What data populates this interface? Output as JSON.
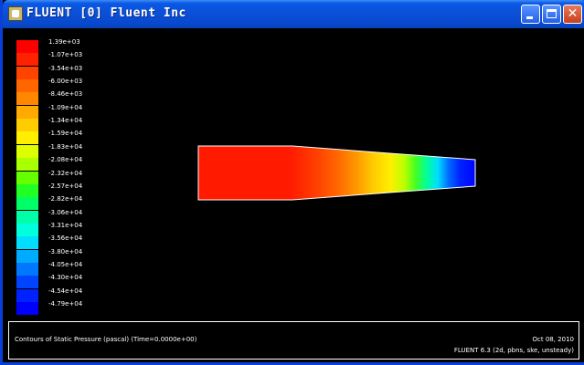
{
  "window": {
    "title": "FLUENT  [0] Fluent Inc",
    "buttons": {
      "minimize": "minimize-icon",
      "maximize": "maximize-icon",
      "close": "close-icon"
    }
  },
  "colormap": {
    "labels": [
      "1.39e+03",
      "-1.07e+03",
      "-3.54e+03",
      "-6.00e+03",
      "-8.46e+03",
      "-1.09e+04",
      "-1.34e+04",
      "-1.59e+04",
      "-1.83e+04",
      "-2.08e+04",
      "-2.32e+04",
      "-2.57e+04",
      "-2.82e+04",
      "-3.06e+04",
      "-3.31e+04",
      "-3.56e+04",
      "-3.80e+04",
      "-4.05e+04",
      "-4.30e+04",
      "-4.54e+04",
      "-4.79e+04"
    ],
    "colors": [
      "#ff0000",
      "#ff2200",
      "#ff4400",
      "#ff6600",
      "#ff8800",
      "#ffaa00",
      "#ffcc00",
      "#ffee00",
      "#ddff00",
      "#aaff00",
      "#66ff00",
      "#22ff22",
      "#00ff66",
      "#00ffaa",
      "#00ffdd",
      "#00ddff",
      "#00aaff",
      "#0077ff",
      "#0044ff",
      "#0022ff",
      "#0000ff"
    ]
  },
  "info": {
    "caption": "Contours of Static Pressure (pascal)  (Time=0.0000e+00)",
    "date": "Oct 08, 2010",
    "solver": "FLUENT 6.3 (2d, pbns, ske, unsteady)"
  }
}
